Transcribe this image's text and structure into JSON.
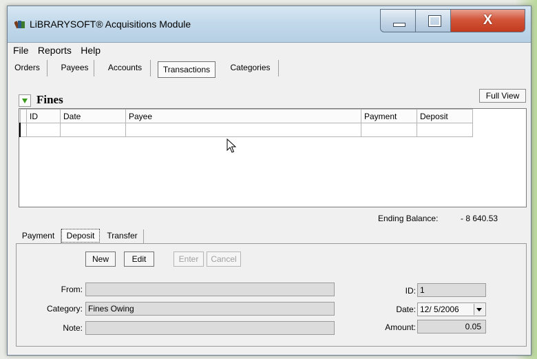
{
  "window": {
    "title": "LiBRARYSOFT® Acquisitions Module",
    "close_glyph": "X"
  },
  "menu": [
    "File",
    "Reports",
    "Help"
  ],
  "tabs": [
    "Orders",
    "Payees",
    "Accounts",
    "Transactions",
    "Categories"
  ],
  "active_tab": "Transactions",
  "section": {
    "title": "Fines",
    "full_view_label": "Full View"
  },
  "grid": {
    "columns": [
      "ID",
      "Date",
      "Payee",
      "Payment",
      "Deposit"
    ],
    "rows": [
      [
        "",
        "",
        "",
        "",
        ""
      ]
    ]
  },
  "balance": {
    "label": "Ending Balance:",
    "value": "- 8 640.53"
  },
  "subtabs": [
    "Payment",
    "Deposit",
    "Transfer"
  ],
  "active_subtab": "Deposit",
  "actions": {
    "new_label": "New",
    "edit_label": "Edit",
    "enter_label": "Enter",
    "cancel_label": "Cancel"
  },
  "form": {
    "from_label": "From:",
    "from_value": "",
    "category_label": "Category:",
    "category_value": "Fines Owing",
    "note_label": "Note:",
    "note_value": "",
    "id_label": "ID:",
    "id_value": "1",
    "date_label": "Date:",
    "date_value": "12/ 5/2006",
    "amount_label": "Amount:",
    "amount_value": "0.05"
  },
  "icons": {
    "app": "books-icon",
    "collapse": "triangle-down-icon",
    "cursor": "mouse-pointer-icon"
  },
  "colors": {
    "accent_green": "#3a9a1a",
    "close_red": "#c23a1e"
  }
}
